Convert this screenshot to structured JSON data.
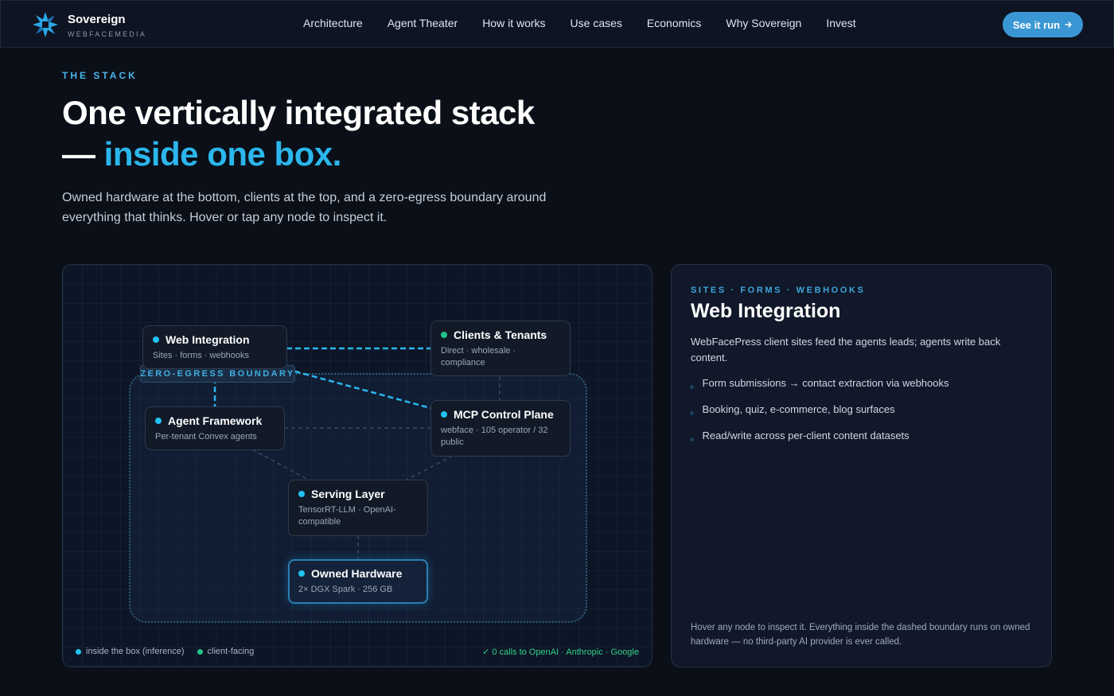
{
  "nav": {
    "brand": "Sovereign",
    "brand_sub": "WEBFACEMEDIA",
    "links": [
      "Architecture",
      "Agent Theater",
      "How it works",
      "Use cases",
      "Economics",
      "Why Sovereign",
      "Invest"
    ],
    "cta_label": "See it run",
    "cta_icon": "arrow-right-icon",
    "accent_color": "#3a97d4"
  },
  "hero": {
    "eyebrow": "THE STACK",
    "headline_line1": "One vertically integrated stack",
    "headline_dash": "— ",
    "headline_accent": "inside one box.",
    "lead": "Owned hardware at the bottom, clients at the top, and a zero-egress boundary around everything that thinks. Hover or tap any node to inspect it."
  },
  "diagram": {
    "boundary_label": "ZERO-EGRESS BOUNDARY",
    "nodes": {
      "web_integration": {
        "title": "Web Integration",
        "sub": "Sites · forms · webhooks",
        "kind": "inside"
      },
      "clients_tenants": {
        "title": "Clients & Tenants",
        "sub": "Direct · wholesale · compliance",
        "kind": "client"
      },
      "agent_framework": {
        "title": "Agent Framework",
        "sub": "Per-tenant Convex agents",
        "kind": "inside"
      },
      "mcp_control": {
        "title": "MCP Control Plane",
        "sub": "webface · 105 operator / 32 public",
        "kind": "inside"
      },
      "serving_layer": {
        "title": "Serving Layer",
        "sub": "TensorRT-LLM · OpenAI-compatible",
        "kind": "inside"
      },
      "owned_hardware": {
        "title": "Owned Hardware",
        "sub": "2× DGX Spark · 256 GB",
        "kind": "inside"
      }
    },
    "legend": {
      "inside": "inside the box (inference)",
      "client": "client-facing"
    },
    "zero_calls": "✓ 0 calls to OpenAI · Anthropic · Google",
    "colors": {
      "inside": "#22c3f1",
      "client": "#22c58a",
      "active_link": "#2bb6ec"
    }
  },
  "detail": {
    "eyebrow": "SITES · FORMS · WEBHOOKS",
    "title": "Web Integration",
    "desc": "WebFacePress client sites feed the agents leads; agents write back content.",
    "items": [
      "Form submissions → contact extraction via webhooks",
      "Booking, quiz, e-commerce, blog surfaces",
      "Read/write across per-client content datasets"
    ],
    "footnote": "Hover any node to inspect it. Everything inside the dashed boundary runs on owned hardware — no third-party AI provider is ever called."
  }
}
